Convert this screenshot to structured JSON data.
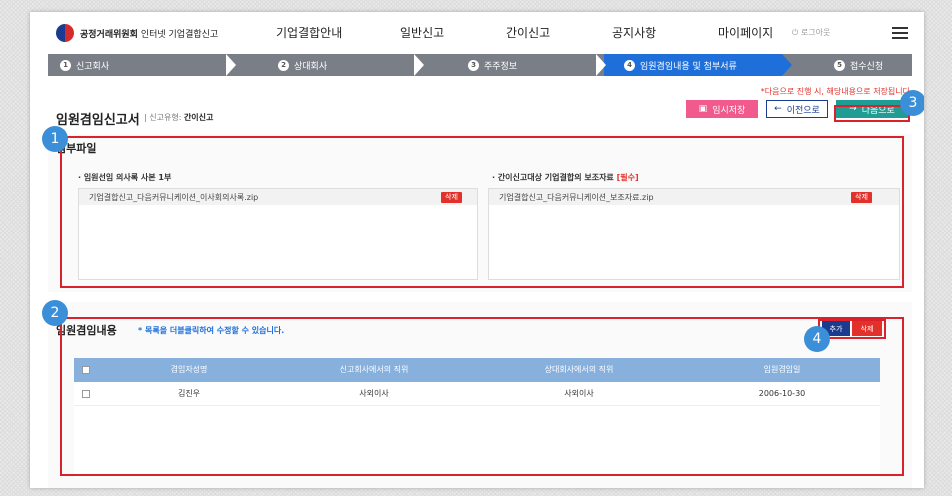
{
  "brand": {
    "strong": "공정거래위원회",
    "rest": " 인터넷 기업결합신고"
  },
  "menu": [
    "기업결합안내",
    "일반신고",
    "간이신고",
    "공지사항",
    "마이페이지"
  ],
  "login": "로그아웃",
  "steps": [
    {
      "num": "1",
      "label": "신고회사"
    },
    {
      "num": "2",
      "label": "상대회사"
    },
    {
      "num": "3",
      "label": "주주정보"
    },
    {
      "num": "4",
      "label": "임원겸임내용 및 첨부서류"
    },
    {
      "num": "5",
      "label": "접수신청"
    }
  ],
  "notice": "*다음으로 진행 시, 해당내용으로 저장됩니다",
  "form": {
    "title": "임원겸임신고서",
    "type_label": "신고유형:",
    "type_value": "간이신고"
  },
  "buttons": {
    "save": "임시저장",
    "prev": "이전으로",
    "next": "다음으로"
  },
  "attach": {
    "title": "첨부파일",
    "left": {
      "heading": "· 임원선임 의사록 사본 1부",
      "file": "기업결합신고_다음커뮤니케이션_이사회의사록.zip",
      "delete": "삭제"
    },
    "right": {
      "heading": "· 간이신고대상 기업결합의 보조자료",
      "required": "[필수]",
      "file": "기업결합신고_다음커뮤니케이션_보조자료.zip",
      "delete": "삭제"
    }
  },
  "officers": {
    "title": "임원겸임내용",
    "hint": "* 목록을 더블클릭하여 수정할 수 있습니다.",
    "add": "추가",
    "delete": "삭제",
    "columns": [
      "겸임자성명",
      "신고회사에서의 직위",
      "상대회사에서의 직위",
      "임원겸임일"
    ],
    "rows": [
      {
        "name": "김진우",
        "pos_self": "사외이사",
        "pos_other": "사외이사",
        "date": "2006-10-30"
      }
    ]
  },
  "callouts": [
    "1",
    "2",
    "3",
    "4"
  ],
  "colors": {
    "accent": "#1e6fd9",
    "annotation": "#d92229",
    "callout": "#3a8fd8",
    "next": "#1f9c94",
    "save": "#f15a8d"
  }
}
